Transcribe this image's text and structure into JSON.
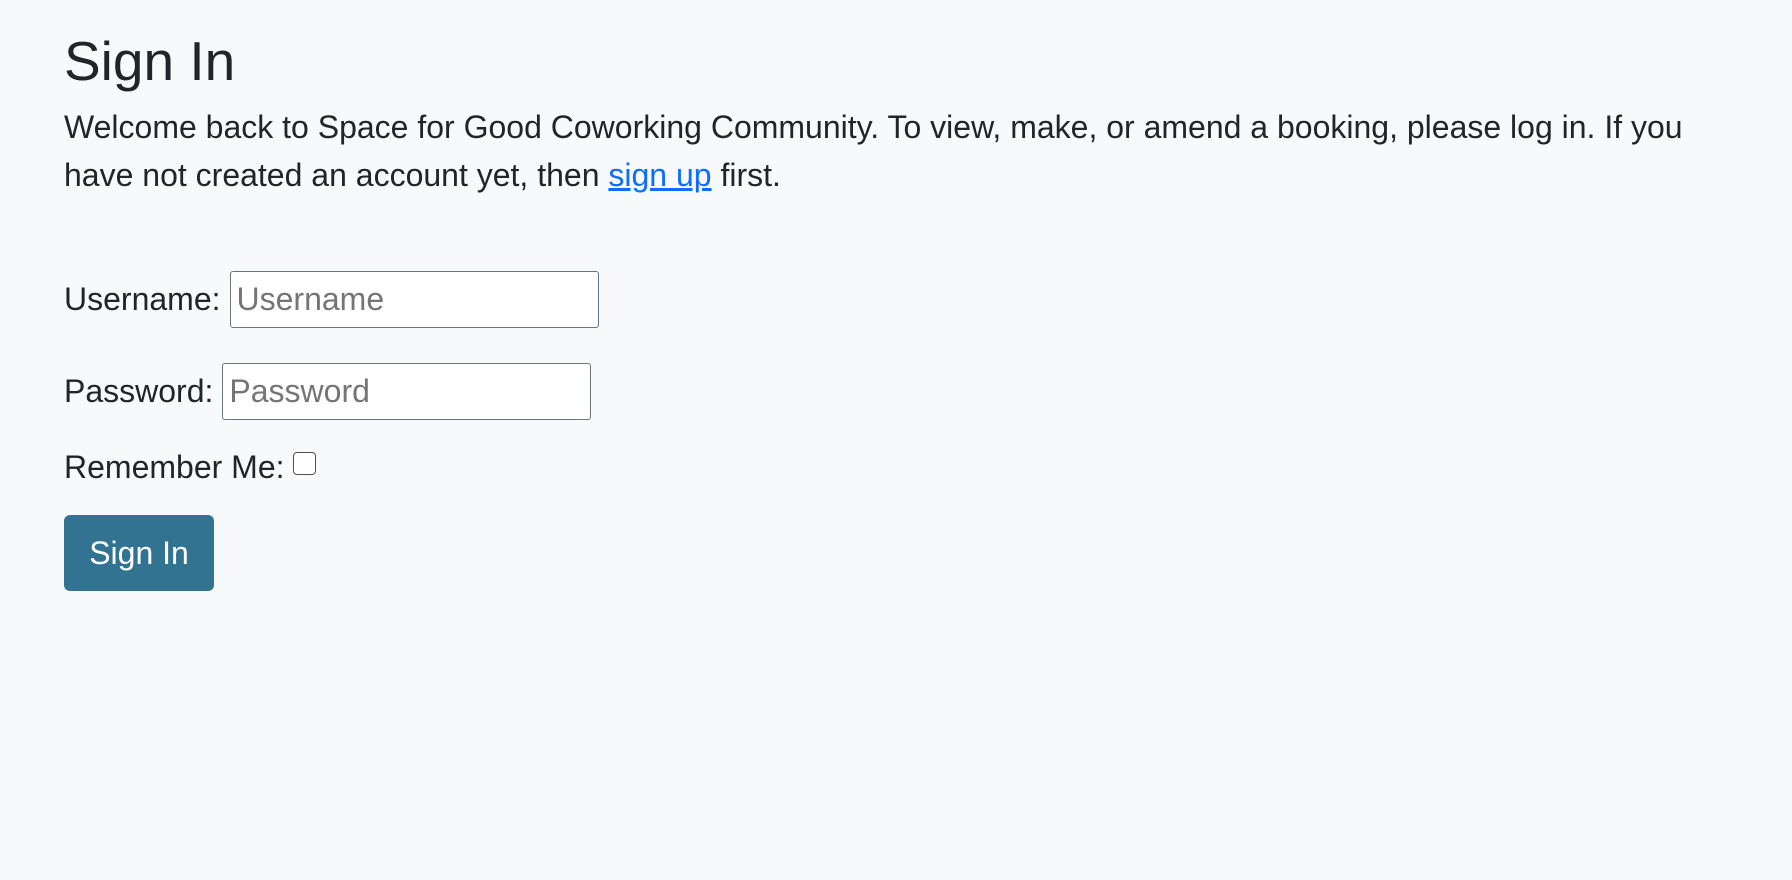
{
  "page": {
    "title": "Sign In",
    "intro_before_link": "Welcome back to Space for Good Coworking Community. To view, make, or amend a booking, please log in. If you have not created an account yet, then ",
    "intro_link": "sign up",
    "intro_after_link": " first."
  },
  "form": {
    "username_label": "Username:",
    "username_placeholder": "Username",
    "username_value": "",
    "password_label": "Password:",
    "password_placeholder": "Password",
    "password_value": "",
    "remember_label": "Remember Me:",
    "remember_checked": false,
    "submit_label": "Sign In"
  },
  "colors": {
    "background": "#f8f9fa",
    "link": "#0d6efd",
    "button": "#337392",
    "text": "#212529"
  }
}
